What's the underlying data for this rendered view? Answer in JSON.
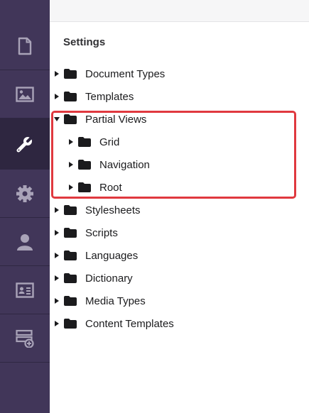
{
  "section": {
    "title": "Settings"
  },
  "sidebar": {
    "items": [
      {
        "name": "content",
        "icon": "document-icon"
      },
      {
        "name": "media",
        "icon": "image-icon"
      },
      {
        "name": "settings",
        "icon": "wrench-icon",
        "active": true
      },
      {
        "name": "packages",
        "icon": "gear-icon"
      },
      {
        "name": "users",
        "icon": "user-icon"
      },
      {
        "name": "members",
        "icon": "id-card-icon"
      },
      {
        "name": "forms",
        "icon": "add-form-icon"
      }
    ]
  },
  "tree": {
    "items": [
      {
        "label": "Document Types",
        "expanded": false
      },
      {
        "label": "Templates",
        "expanded": false
      },
      {
        "label": "Partial Views",
        "expanded": true,
        "children": [
          {
            "label": "Grid"
          },
          {
            "label": "Navigation"
          },
          {
            "label": "Root"
          }
        ]
      },
      {
        "label": "Stylesheets",
        "expanded": false
      },
      {
        "label": "Scripts",
        "expanded": false
      },
      {
        "label": "Languages",
        "expanded": false
      },
      {
        "label": "Dictionary",
        "expanded": false
      },
      {
        "label": "Media Types",
        "expanded": false
      },
      {
        "label": "Content Templates",
        "expanded": false
      }
    ]
  },
  "colors": {
    "sidebar_bg": "#413659",
    "sidebar_active": "#2e2640",
    "icon_default": "#a9a3b8",
    "icon_active": "#ffffff",
    "highlight": "#e0393f"
  }
}
